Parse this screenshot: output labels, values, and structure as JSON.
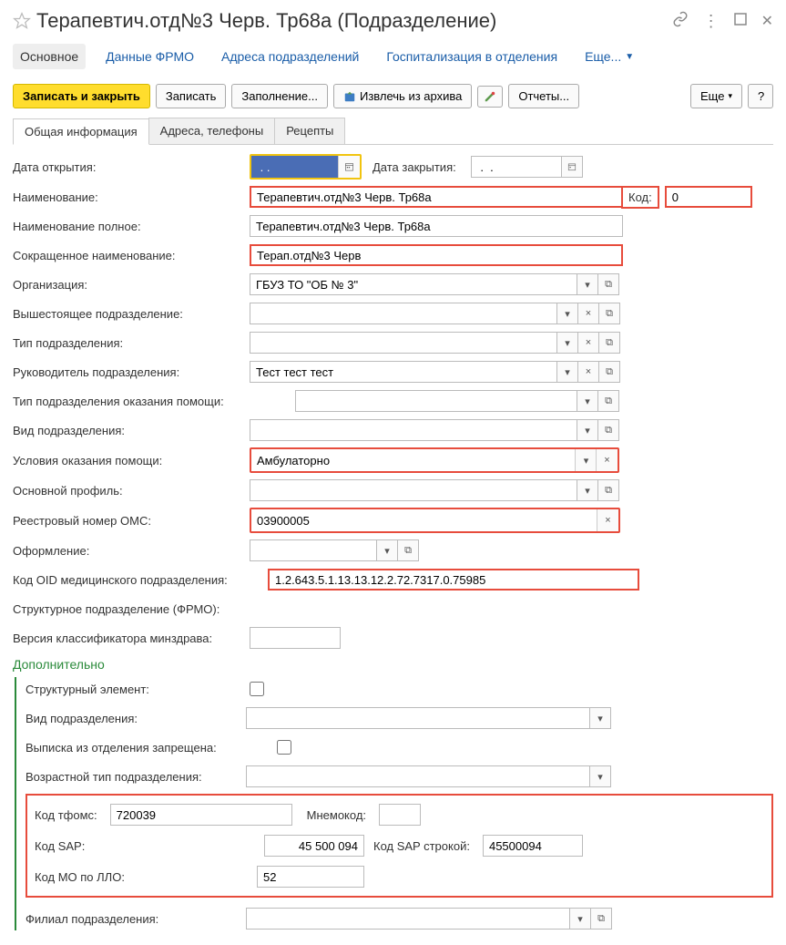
{
  "header": {
    "title": "Терапевтич.отд№3 Черв. Тр68а (Подразделение)"
  },
  "nav": {
    "items": [
      "Основное",
      "Данные ФРМО",
      "Адреса подразделений",
      "Госпитализация в отделения"
    ],
    "more": "Еще..."
  },
  "toolbar": {
    "save_close": "Записать и закрыть",
    "save": "Записать",
    "fill": "Заполнение...",
    "extract": "Извлечь из архива",
    "reports": "Отчеты...",
    "more": "Еще",
    "help": "?"
  },
  "tabs": {
    "general": "Общая информация",
    "addresses": "Адреса, телефоны",
    "recipes": "Рецепты"
  },
  "fields": {
    "open_date_label": "Дата открытия:",
    "open_date_value": " . .",
    "close_date_label": "Дата закрытия:",
    "close_date_value": " .  .",
    "name_label": "Наименование:",
    "name_value": "Терапевтич.отд№3 Черв. Тр68а",
    "code_label": "Код:",
    "code_value": "0",
    "full_name_label": "Наименование полное:",
    "full_name_value": "Терапевтич.отд№3 Черв. Тр68а",
    "short_name_label": "Сокращенное наименование:",
    "short_name_value": "Терап.отд№3 Черв",
    "org_label": "Организация:",
    "org_value": "ГБУЗ ТО \"ОБ № 3\"",
    "parent_label": "Вышестоящее подразделение:",
    "parent_value": "",
    "type_label": "Тип подразделения:",
    "type_value": "",
    "head_label": "Руководитель подразделения:",
    "head_value": "Тест тест тест",
    "help_type_label": "Тип подразделения оказания помощи:",
    "help_type_value": "",
    "kind_label": "Вид подразделения:",
    "kind_value": "",
    "conditions_label": "Условия оказания помощи:",
    "conditions_value": "Амбулаторно",
    "profile_label": "Основной профиль:",
    "profile_value": "",
    "oms_label": "Реестровый номер ОМС:",
    "oms_value": "03900005",
    "design_label": "Оформление:",
    "design_value": "",
    "oid_label": "Код OID медицинского подразделения:",
    "oid_value": "1.2.643.5.1.13.13.12.2.72.7317.0.75985",
    "struct_label": "Структурное подразделение (ФРМО):",
    "class_ver_label": "Версия классификатора минздрава:",
    "class_ver_value": ""
  },
  "additional": {
    "title": "Дополнительно",
    "struct_elem_label": "Структурный элемент:",
    "kind2_label": "Вид подразделения:",
    "discharge_label": "Выписка из отделения запрещена:",
    "age_type_label": "Возрастной тип подразделения:",
    "tfoms_label": "Код тфомс:",
    "tfoms_value": "720039",
    "mnemo_label": "Мнемокод:",
    "mnemo_value": "",
    "sap_label": "Код SAP:",
    "sap_value": "45 500 094",
    "sap_str_label": "Код SAP строкой:",
    "sap_str_value": "45500094",
    "mo_llo_label": "Код МО по ЛЛО:",
    "mo_llo_value": "52",
    "branch_label": "Филиал подразделения:"
  }
}
